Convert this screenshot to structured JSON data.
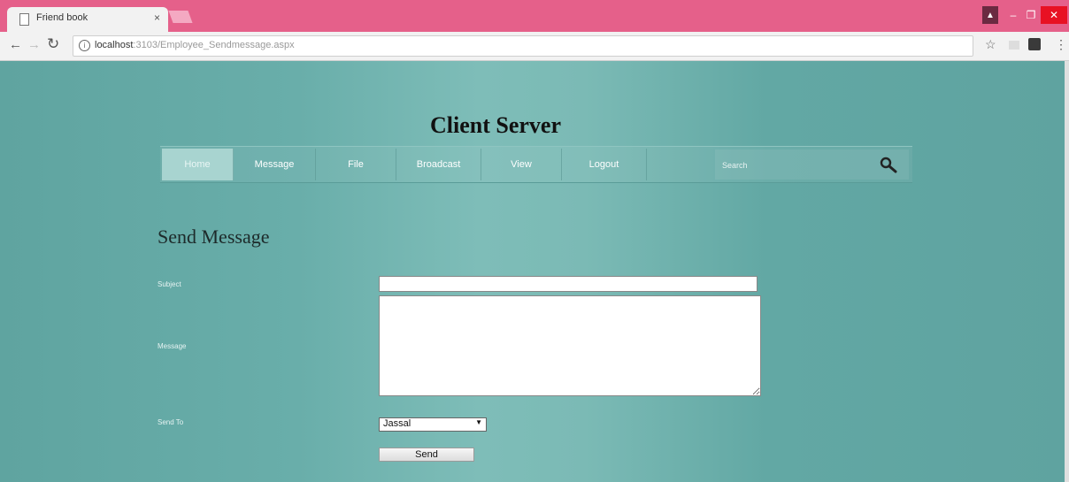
{
  "browser": {
    "tab_title": "Friend book",
    "tab_close": "×",
    "url_host": "localhost",
    "url_rest": ":3103/Employee_Sendmessage.aspx"
  },
  "site": {
    "title": "Client Server",
    "nav": [
      {
        "label": "Home",
        "active": true
      },
      {
        "label": "Message"
      },
      {
        "label": "File"
      },
      {
        "label": "Broadcast"
      },
      {
        "label": "View"
      },
      {
        "label": "Logout"
      }
    ],
    "search_placeholder": "Search"
  },
  "form": {
    "heading": "Send Message",
    "subject_label": "Subject",
    "subject_value": "",
    "message_label": "Message",
    "message_value": "",
    "sendto_label": "Send To",
    "sendto_value": "Jassal",
    "send_button": "Send"
  }
}
